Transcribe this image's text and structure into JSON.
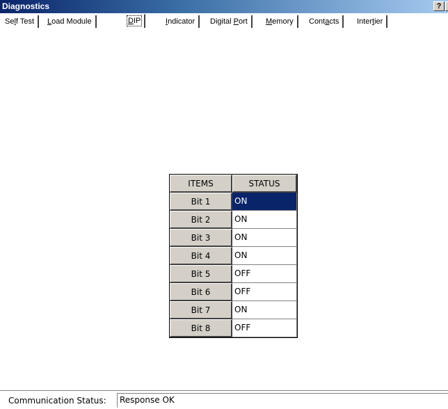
{
  "window": {
    "title": "Diagnostics",
    "help_label": "?",
    "close_label": "×"
  },
  "tabs": [
    {
      "label": "Self Test",
      "active": false
    },
    {
      "label": "Load Module",
      "active": false
    },
    {
      "label": "DIP",
      "active": true
    },
    {
      "label": "Indicator",
      "active": false
    },
    {
      "label": "Digital Port",
      "active": false
    },
    {
      "label": "Memory",
      "active": false
    },
    {
      "label": "Contacts",
      "active": false
    },
    {
      "label": "Intertier",
      "active": false
    }
  ],
  "dip_table": {
    "headers": {
      "items": "ITEMS",
      "status": "STATUS"
    },
    "rows": [
      {
        "item": "Bit 1",
        "status": "ON",
        "selected": true
      },
      {
        "item": "Bit 2",
        "status": "ON",
        "selected": false
      },
      {
        "item": "Bit 3",
        "status": "ON",
        "selected": false
      },
      {
        "item": "Bit 4",
        "status": "ON",
        "selected": false
      },
      {
        "item": "Bit 5",
        "status": "OFF",
        "selected": false
      },
      {
        "item": "Bit 6",
        "status": "OFF",
        "selected": false
      },
      {
        "item": "Bit 7",
        "status": "ON",
        "selected": false
      },
      {
        "item": "Bit 8",
        "status": "OFF",
        "selected": false
      }
    ]
  },
  "status_bar": {
    "label": "Communication Status:",
    "value": "Response OK"
  },
  "colors": {
    "title_bar": "#0a246a",
    "selection": "#0a246a",
    "face": "#d4d0c8"
  }
}
